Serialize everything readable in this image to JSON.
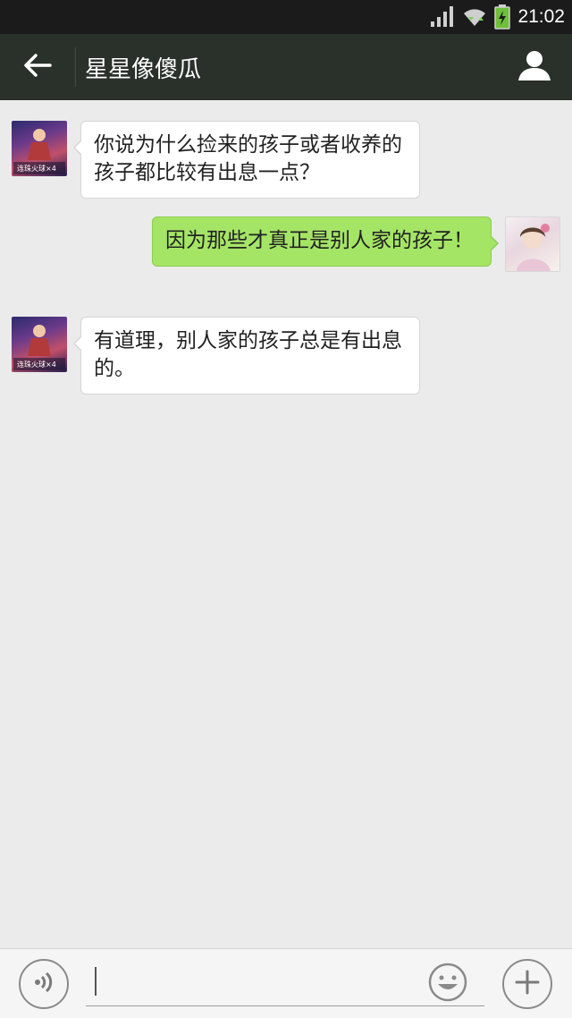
{
  "status_bar": {
    "time": "21:02",
    "icons": [
      "signal-icon",
      "wifi-icon",
      "battery-charging-icon"
    ]
  },
  "nav": {
    "title": "星星像傻瓜",
    "back_icon": "arrow-left-icon",
    "profile_icon": "user-icon"
  },
  "messages": [
    {
      "side": "left",
      "text": "你说为什么捡来的孩子或者收养的孩子都比较有出息一点？"
    },
    {
      "side": "right",
      "text": "因为那些才真正是别人家的孩子！"
    },
    {
      "side": "left",
      "text": "有道理，别人家的孩子总是有出息的。"
    }
  ],
  "avatars": {
    "left_caption": "连珠火球×4"
  },
  "input_bar": {
    "voice_icon": "voice-icon",
    "emoji_icon": "emoji-icon",
    "plus_icon": "plus-icon",
    "value": ""
  },
  "colors": {
    "status_bar": "#1b1b1b",
    "nav_bar": "#2a302a",
    "chat_bg": "#ebebeb",
    "sent_bubble": "#a5e566",
    "received_bubble": "#ffffff"
  }
}
